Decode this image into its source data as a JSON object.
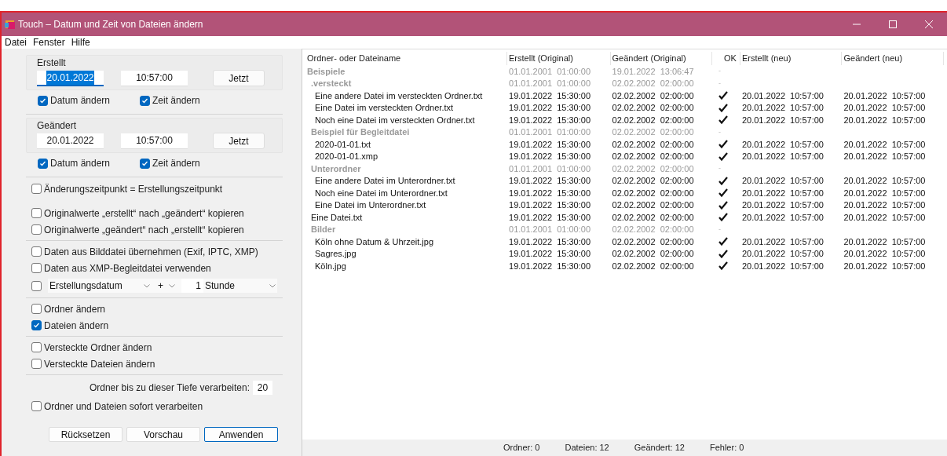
{
  "window": {
    "title": "Touch – Datum und Zeit von Dateien ändern"
  },
  "menu": [
    "Datei",
    "Fenster",
    "Hilfe"
  ],
  "groups": [
    {
      "title": "Erstellt",
      "date": {
        "value": "20.01.2022",
        "text_selected": true
      },
      "time": {
        "value": "10:57:00"
      },
      "button": "Jetzt",
      "checks": [
        {
          "label": "Datum ändern",
          "checked": true
        },
        {
          "label": "Zeit ändern",
          "checked": true
        }
      ]
    },
    {
      "title": "Geändert",
      "date": {
        "value": "20.01.2022",
        "text_selected": false
      },
      "time": {
        "value": "10:57:00"
      },
      "button": "Jetzt",
      "checks": [
        {
          "label": "Datum ändern",
          "checked": true
        },
        {
          "label": "Zeit ändern",
          "checked": true
        }
      ]
    }
  ],
  "options": [
    {
      "kind": "check",
      "label": "Änderungszeitpunkt = Erstellungszeitpunkt",
      "checked": false
    },
    {
      "kind": "divider"
    },
    {
      "kind": "check",
      "label": "Originalwerte „erstellt“ nach „geändert“ kopieren",
      "checked": false
    },
    {
      "kind": "check",
      "label": "Originalwerte „geändert“ nach „erstellt“ kopieren",
      "checked": false
    },
    {
      "kind": "rule"
    },
    {
      "kind": "check",
      "label": "Daten aus Bilddatei übernehmen (Exif, IPTC, XMP)",
      "checked": false
    },
    {
      "kind": "check",
      "label": "Daten aus XMP-Begleitdatei verwenden",
      "checked": false
    },
    {
      "kind": "offset",
      "checked": false,
      "field": "Erstellungsdatum",
      "sign": "+",
      "amount": "1",
      "unit": "Stunde"
    },
    {
      "kind": "rule"
    },
    {
      "kind": "check",
      "label": "Ordner ändern",
      "checked": false
    },
    {
      "kind": "check",
      "label": "Dateien ändern",
      "checked": true
    },
    {
      "kind": "rule"
    },
    {
      "kind": "check",
      "label": "Versteckte Ordner ändern",
      "checked": false
    },
    {
      "kind": "check",
      "label": "Versteckte Dateien ändern",
      "checked": false
    },
    {
      "kind": "rule"
    },
    {
      "kind": "depth",
      "label": "Ordner bis zu dieser Tiefe verarbeiten:",
      "value": "20"
    },
    {
      "kind": "check",
      "label": "Ordner und Dateien sofort verarbeiten",
      "checked": false
    }
  ],
  "actions": [
    {
      "label": "Rücksetzen",
      "default": false
    },
    {
      "label": "Vorschau",
      "default": false
    },
    {
      "label": "Anwenden",
      "default": true
    }
  ],
  "table": {
    "columns": [
      "Ordner- oder Dateiname",
      "Erstellt (Original)",
      "Geändert (Original)",
      "OK",
      "Erstellt (neu)",
      "Geändert (neu)"
    ],
    "rows": [
      {
        "kind": "folder",
        "name": "Beispiele",
        "created": "01.01.2001  01:00:00",
        "modified": "19.01.2022  13:06:47",
        "status": "-",
        "children": [
          {
            "kind": "folder",
            "name": ".versteckt",
            "created": "01.01.2001  01:00:00",
            "modified": "02.02.2002  02:00:00",
            "status": "-",
            "children": [
              {
                "kind": "file",
                "name": "Eine andere Datei im versteckten Ordner.txt",
                "created": "19.01.2022  15:30:00",
                "modified": "02.02.2002  02:00:00",
                "ok": true,
                "created_new": "20.01.2022  10:57:00",
                "modified_new": "20.01.2022  10:57:00"
              },
              {
                "kind": "file",
                "name": "Eine Datei im versteckten Ordner.txt",
                "created": "19.01.2022  15:30:00",
                "modified": "02.02.2002  02:00:00",
                "ok": true,
                "created_new": "20.01.2022  10:57:00",
                "modified_new": "20.01.2022  10:57:00"
              },
              {
                "kind": "file",
                "name": "Noch eine Datei im versteckten Ordner.txt",
                "created": "19.01.2022  15:30:00",
                "modified": "02.02.2002  02:00:00",
                "ok": true,
                "created_new": "20.01.2022  10:57:00",
                "modified_new": "20.01.2022  10:57:00"
              }
            ]
          },
          {
            "kind": "folder",
            "name": "Beispiel für Begleitdatei",
            "created": "01.01.2001  01:00:00",
            "modified": "02.02.2002  02:00:00",
            "status": "-",
            "children": [
              {
                "kind": "file",
                "name": "2020-01-01.txt",
                "created": "19.01.2022  15:30:00",
                "modified": "02.02.2002  02:00:00",
                "ok": true,
                "created_new": "20.01.2022  10:57:00",
                "modified_new": "20.01.2022  10:57:00"
              },
              {
                "kind": "file",
                "name": "2020-01-01.xmp",
                "created": "19.01.2022  15:30:00",
                "modified": "02.02.2002  02:00:00",
                "ok": true,
                "created_new": "20.01.2022  10:57:00",
                "modified_new": "20.01.2022  10:57:00"
              }
            ]
          },
          {
            "kind": "folder",
            "name": "Unterordner",
            "created": "01.01.2001  01:00:00",
            "modified": "02.02.2002  02:00:00",
            "status": "-",
            "children": [
              {
                "kind": "file",
                "name": "Eine andere Datei im Unterordner.txt",
                "created": "19.01.2022  15:30:00",
                "modified": "02.02.2002  02:00:00",
                "ok": true,
                "created_new": "20.01.2022  10:57:00",
                "modified_new": "20.01.2022  10:57:00"
              },
              {
                "kind": "file",
                "name": "Noch eine Datei im Unterordner.txt",
                "created": "19.01.2022  15:30:00",
                "modified": "02.02.2002  02:00:00",
                "ok": true,
                "created_new": "20.01.2022  10:57:00",
                "modified_new": "20.01.2022  10:57:00"
              },
              {
                "kind": "file",
                "name": "Eine Datei im Unterordner.txt",
                "created": "19.01.2022  15:30:00",
                "modified": "02.02.2002  02:00:00",
                "ok": true,
                "created_new": "20.01.2022  10:57:00",
                "modified_new": "20.01.2022  10:57:00"
              }
            ]
          },
          {
            "kind": "file",
            "name": "Eine Datei.txt",
            "created": "19.01.2022  15:30:00",
            "modified": "02.02.2002  02:00:00",
            "ok": true,
            "created_new": "20.01.2022  10:57:00",
            "modified_new": "20.01.2022  10:57:00"
          },
          {
            "kind": "folder",
            "name": "Bilder",
            "created": "01.01.2001  01:00:00",
            "modified": "02.02.2002  02:00:00",
            "status": "-",
            "children": [
              {
                "kind": "file",
                "name": "Köln ohne Datum & Uhrzeit.jpg",
                "created": "19.01.2022  15:30:00",
                "modified": "02.02.2002  02:00:00",
                "ok": true,
                "created_new": "20.01.2022  10:57:00",
                "modified_new": "20.01.2022  10:57:00"
              },
              {
                "kind": "file",
                "name": "Sagres.jpg",
                "created": "19.01.2022  15:30:00",
                "modified": "02.02.2002  02:00:00",
                "ok": true,
                "created_new": "20.01.2022  10:57:00",
                "modified_new": "20.01.2022  10:57:00"
              },
              {
                "kind": "file",
                "name": "Köln.jpg",
                "created": "19.01.2022  15:30:00",
                "modified": "02.02.2002  02:00:00",
                "ok": true,
                "created_new": "20.01.2022  10:57:00",
                "modified_new": "20.01.2022  10:57:00"
              }
            ]
          }
        ]
      }
    ]
  },
  "status_bar": [
    "Ordner: 0",
    "Dateien: 12",
    "Geändert: 12",
    "Fehler: 0"
  ]
}
